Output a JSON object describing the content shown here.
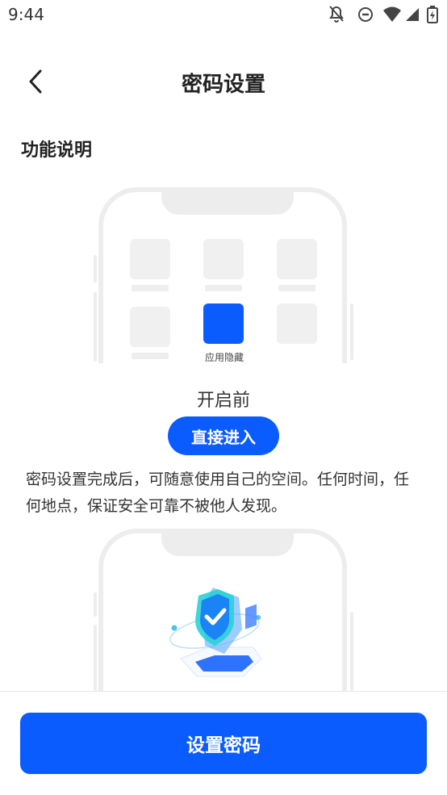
{
  "status_bar": {
    "time": "9:44",
    "icons": [
      "notifications-off-icon",
      "do-not-disturb-icon",
      "wifi-icon",
      "cell-signal-icon",
      "battery-charging-icon"
    ]
  },
  "header": {
    "title": "密码设置",
    "back_icon": "chevron-left-icon"
  },
  "section": {
    "title": "功能说明"
  },
  "demo_before": {
    "hidden_app_label": "应用隐藏",
    "caption": "开启前",
    "action_label": "直接进入"
  },
  "description": "密码设置完成后，可随意使用自己的空间。任何时间，任何地点，保证安全可靠不被他人发现。",
  "demo_after": {
    "illustration": "security-shield-icon"
  },
  "footer": {
    "button_label": "设置密码"
  },
  "colors": {
    "accent": "#0a5cff",
    "mockup_frame": "#ededed",
    "tile": "#f0f0f0"
  }
}
